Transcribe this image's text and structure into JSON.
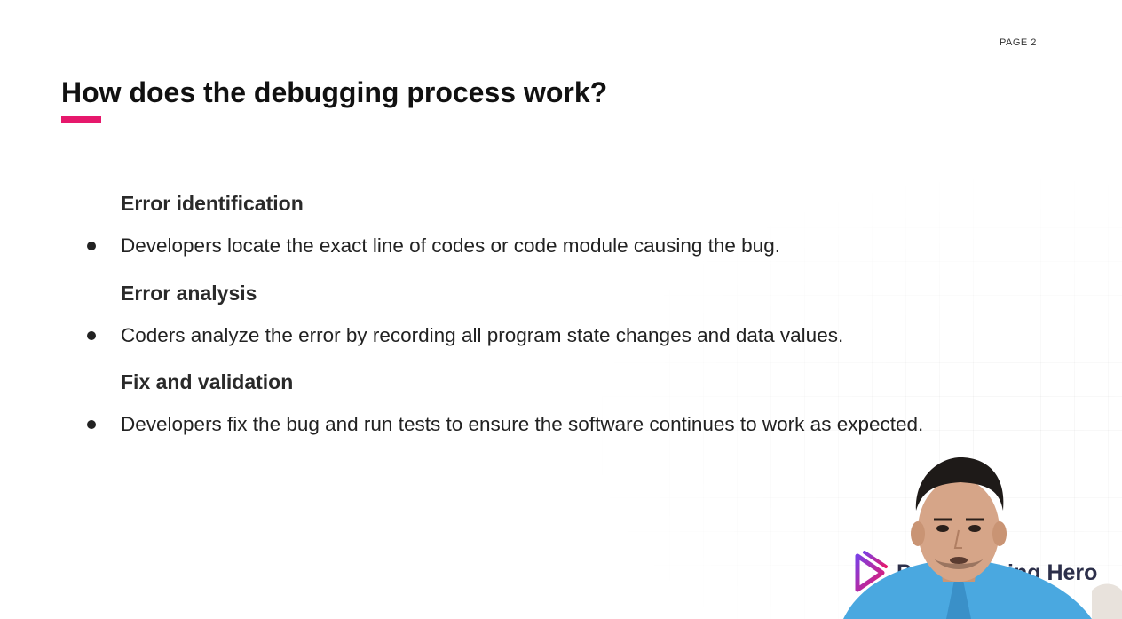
{
  "page": {
    "label": "PAGE 2",
    "accent_color": "#e6186c"
  },
  "slide": {
    "title": "How does the debugging process work?",
    "sections": [
      {
        "heading": "Error identification",
        "bullet": "Developers locate the exact line of codes or code module causing the bug."
      },
      {
        "heading": "Error analysis",
        "bullet": "Coders analyze the error by recording all program state changes and data values."
      },
      {
        "heading": "Fix and validation",
        "bullet": "Developers fix the bug and run tests to ensure the software continues to work as expected."
      }
    ]
  },
  "overlay": {
    "brand_name": "Programming Hero",
    "brand_icon": "play-logo-icon",
    "presenter": "presenter-webcam"
  }
}
